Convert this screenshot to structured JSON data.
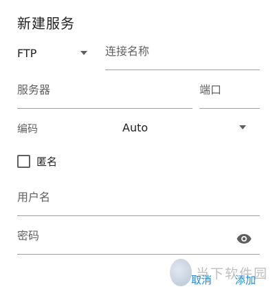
{
  "dialog": {
    "title": "新建服务"
  },
  "form": {
    "protocol": "FTP",
    "connection_name_placeholder": "连接名称",
    "server_placeholder": "服务器",
    "port_placeholder": "端口",
    "encoding_label": "编码",
    "encoding_value": "Auto",
    "anonymous_label": "匿名",
    "anonymous_checked": false,
    "username_placeholder": "用户名",
    "password_placeholder": "密码",
    "password_icon": "eye-icon"
  },
  "actions": {
    "cancel_label": "取消",
    "add_label": "添加"
  },
  "watermark": {
    "text": "当下软件园"
  },
  "colors": {
    "accent": "#1e88e5",
    "text": "#212121",
    "hint": "#616161",
    "underline": "#9e9e9e"
  }
}
